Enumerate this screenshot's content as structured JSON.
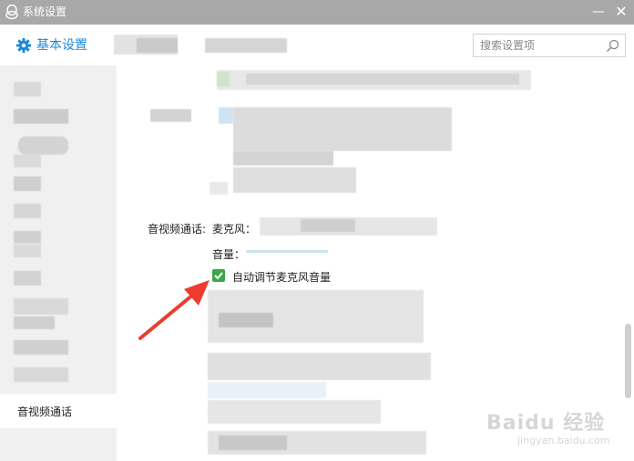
{
  "window": {
    "title": "系统设置"
  },
  "header": {
    "basic_settings": "基本设置",
    "search_placeholder": "搜索设置项"
  },
  "sidebar": {
    "active_item": "音视频通话"
  },
  "av_section": {
    "section_label": "音视频通话:",
    "microphone_label": "麦克风：",
    "volume_label": "音量：",
    "auto_adjust_label": "自动调节麦克风音量",
    "auto_adjust_checked": true
  },
  "colors": {
    "accent": "#1e88d8",
    "checkbox": "#3ca64c",
    "arrow": "#ee3b2f",
    "titlebar": "#a8a8a8"
  },
  "icons": [
    "qq-penguin-icon",
    "gear-icon",
    "search-icon",
    "minimize-icon",
    "close-icon",
    "check-icon",
    "red-arrow-annotation"
  ]
}
